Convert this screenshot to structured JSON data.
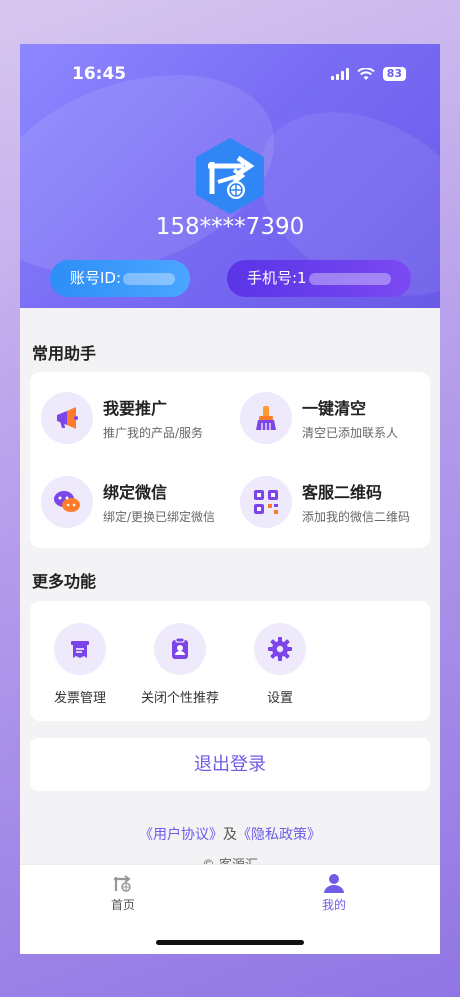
{
  "status_bar": {
    "time": "16:45",
    "battery": "83"
  },
  "profile": {
    "phone_number": "158****7390",
    "account_id_label": "账号ID:",
    "mobile_label": "手机号:1"
  },
  "common_helpers": {
    "title": "常用助手",
    "items": [
      {
        "title": "我要推广",
        "subtitle": "推广我的产品/服务",
        "icon": "megaphone-icon"
      },
      {
        "title": "一键清空",
        "subtitle": "清空已添加联系人",
        "icon": "broom-icon"
      },
      {
        "title": "绑定微信",
        "subtitle": "绑定/更换已绑定微信",
        "icon": "wechat-icon"
      },
      {
        "title": "客服二维码",
        "subtitle": "添加我的微信二维码",
        "icon": "qrcode-icon"
      }
    ]
  },
  "more_functions": {
    "title": "更多功能",
    "items": [
      {
        "label": "发票管理",
        "icon": "invoice-icon"
      },
      {
        "label": "关闭个性推荐",
        "icon": "clipboard-user-icon"
      },
      {
        "label": "设置",
        "icon": "gear-icon"
      }
    ]
  },
  "logout": {
    "label": "退出登录"
  },
  "agreement": {
    "user_agreement": "《用户协议》",
    "and": "及",
    "privacy_policy": "《隐私政策》"
  },
  "copyright": "© 客源汇",
  "tabbar": {
    "items": [
      {
        "label": "首页",
        "icon": "home-logo-icon",
        "active": false
      },
      {
        "label": "我的",
        "icon": "user-icon",
        "active": true
      }
    ]
  },
  "colors": {
    "accent": "#6d5de8",
    "hero_start": "#8d87ff",
    "hero_end": "#6a5ae8",
    "blue_pill": "#2d8ef7",
    "purple_pill": "#5a34e6"
  }
}
